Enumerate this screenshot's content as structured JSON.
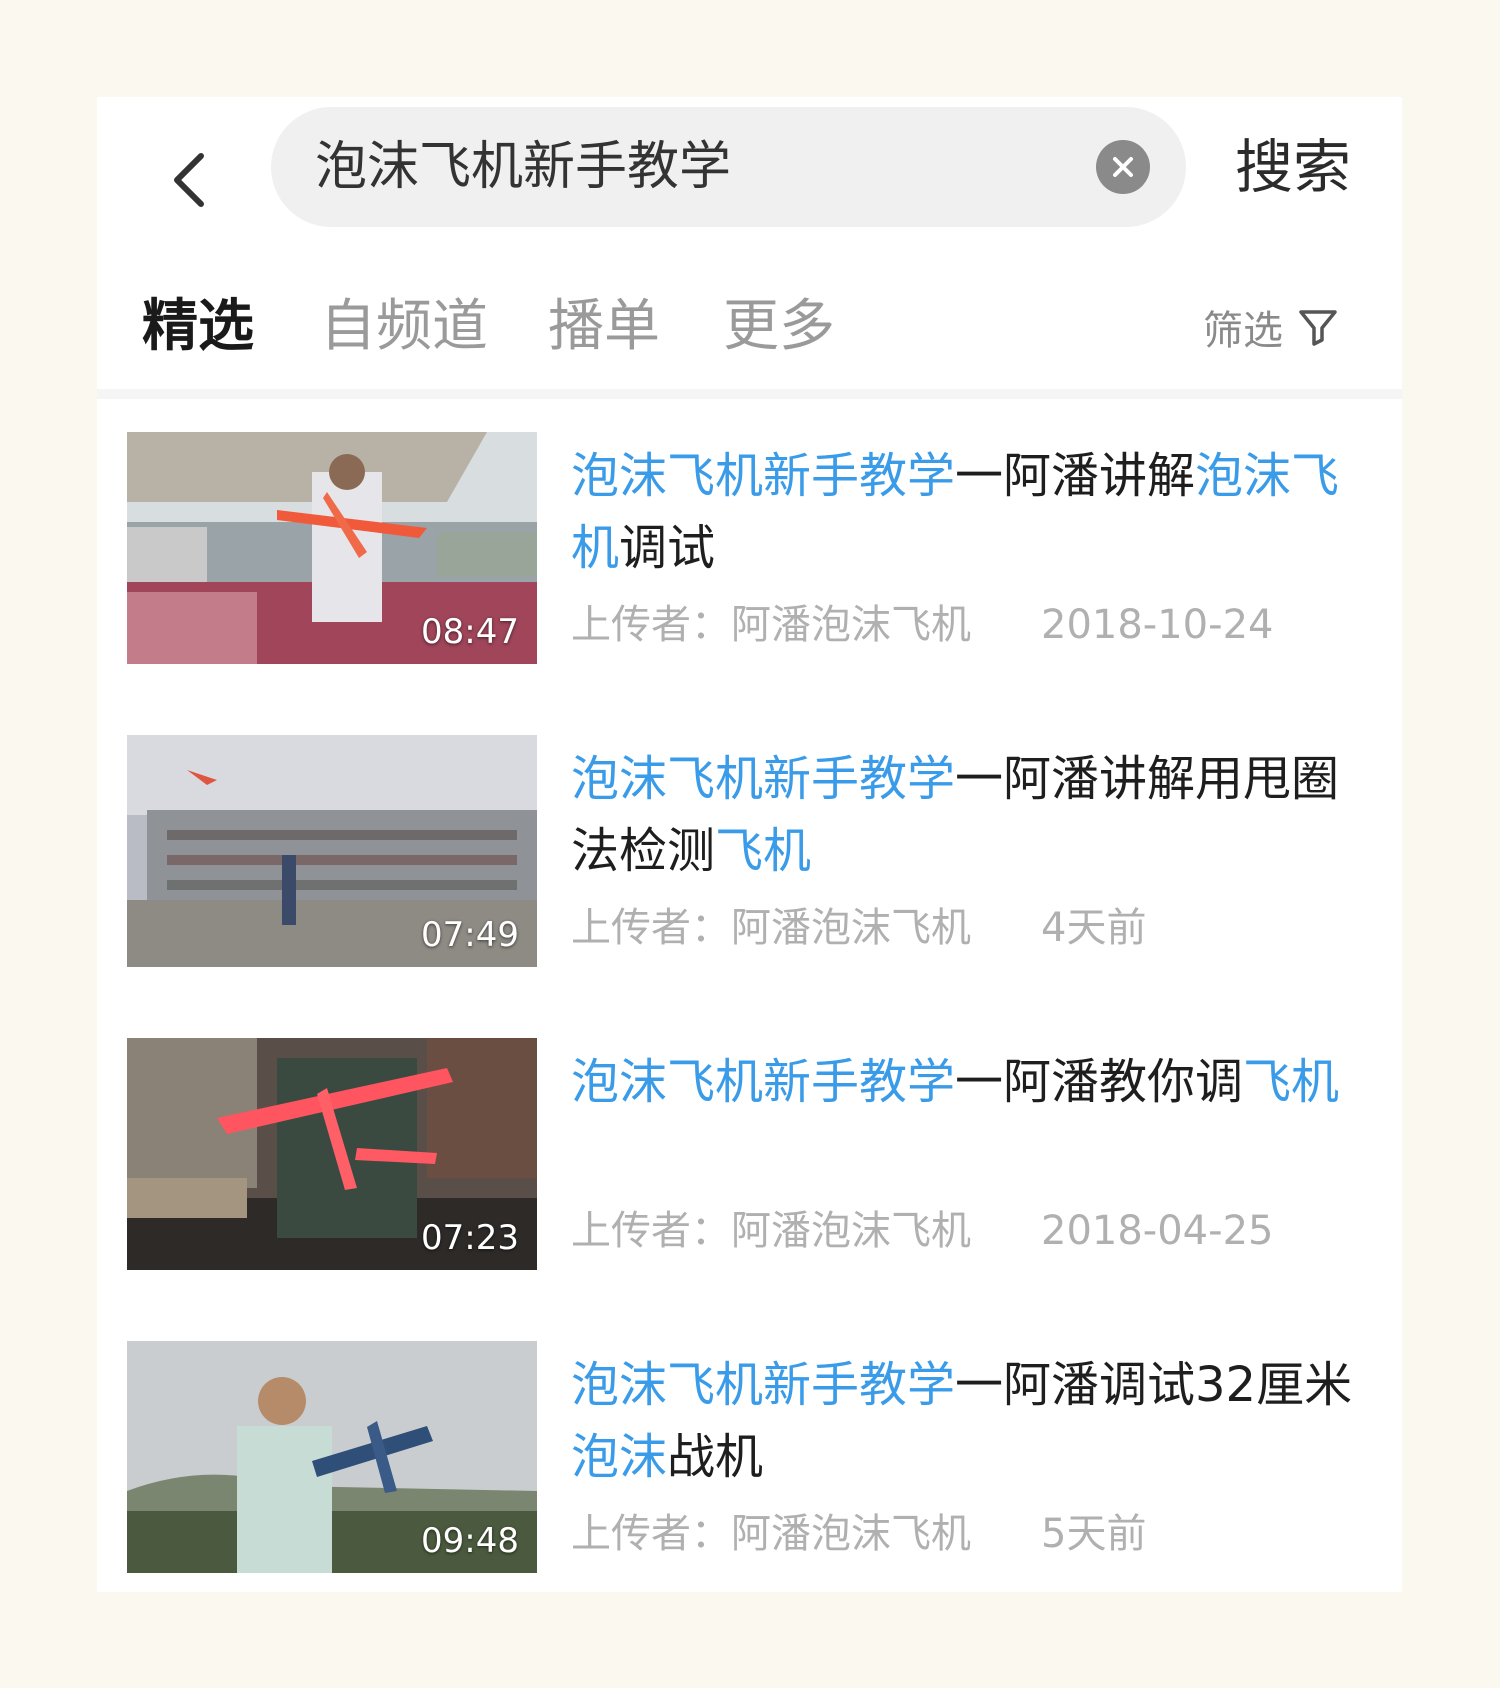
{
  "search": {
    "back_icon": "chevron-left-icon",
    "query": "泡沫飞机新手教学",
    "clear_icon": "clear-circle-icon",
    "button_label": "搜索"
  },
  "tabs": [
    {
      "label": "精选",
      "active": true
    },
    {
      "label": "自频道",
      "active": false
    },
    {
      "label": "播单",
      "active": false
    },
    {
      "label": "更多",
      "active": false
    }
  ],
  "filter": {
    "label": "筛选",
    "icon": "filter-funnel-icon"
  },
  "results": [
    {
      "duration": "08:47",
      "title_parts": [
        {
          "text": "泡沫飞机新手教学",
          "hl": true
        },
        {
          "text": "一阿潘讲解",
          "hl": false
        },
        {
          "text": "泡沫飞机",
          "hl": true
        },
        {
          "text": "调试",
          "hl": false
        }
      ],
      "uploader": "上传者：阿潘泡沫飞机",
      "date": "2018-10-24"
    },
    {
      "duration": "07:49",
      "title_parts": [
        {
          "text": "泡沫飞机新手教学",
          "hl": true
        },
        {
          "text": "一阿潘讲解用甩圈法检测",
          "hl": false
        },
        {
          "text": "飞机",
          "hl": true
        }
      ],
      "uploader": "上传者：阿潘泡沫飞机",
      "date": "4天前"
    },
    {
      "duration": "07:23",
      "title_parts": [
        {
          "text": "泡沫飞机新手教学",
          "hl": true
        },
        {
          "text": "一阿潘教你调",
          "hl": false
        },
        {
          "text": "飞机",
          "hl": true
        }
      ],
      "uploader": "上传者：阿潘泡沫飞机",
      "date": "2018-04-25"
    },
    {
      "duration": "09:48",
      "title_parts": [
        {
          "text": "泡沫飞机新手教学",
          "hl": true
        },
        {
          "text": "一阿潘调试32厘米",
          "hl": false
        },
        {
          "text": "泡沫",
          "hl": true
        },
        {
          "text": "战机",
          "hl": false
        }
      ],
      "uploader": "上传者：阿潘泡沫飞机",
      "date": "5天前"
    }
  ],
  "colors": {
    "highlight": "#3a9be8",
    "text": "#1e1e1e",
    "meta": "#b0b0b0"
  }
}
